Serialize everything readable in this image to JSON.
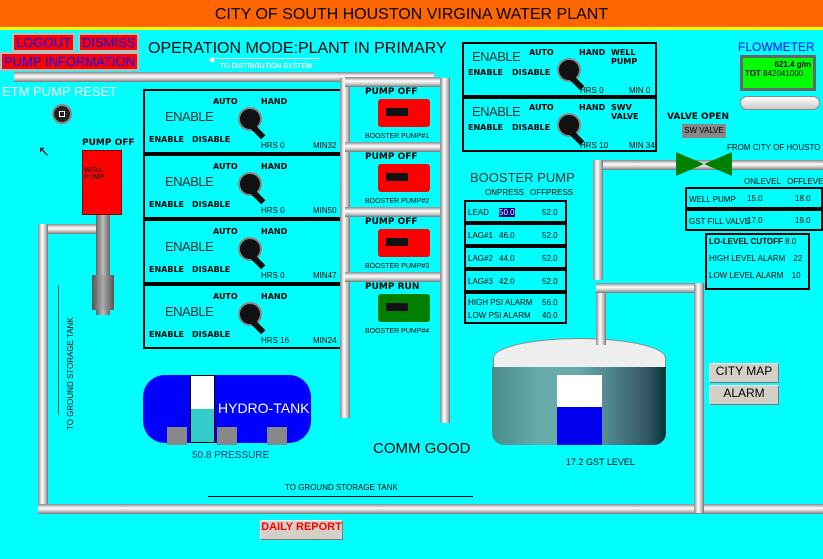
{
  "title": "CITY OF SOUTH HOUSTON VIRGINA WATER PLANT",
  "buttons": {
    "logout": "LOGOUT",
    "dismiss": "DISMISS",
    "pump_information": "PUMP INFORMATION",
    "city_map": "CITY MAP",
    "alarm": "ALARM",
    "daily_report": "DAILY REPORT"
  },
  "operation_mode": "OPERATION MODE:PLANT IN PRIMARY",
  "labels": {
    "to_distribution": "TO DISTRIBUTION SYSTEM",
    "etm_reset": "ETM PUMP RESET",
    "to_gst_vertical": "TO GROUND STORAGE TANK",
    "to_gst_horizontal": "TO GROUND STORAGE TANK",
    "from_city": "FROM CITY OF HOUSTO",
    "comm": "COMM GOOD",
    "flowmeter": "FLOWMETER"
  },
  "well_pump": {
    "status": "PUMP OFF",
    "label": "WELL PUMP"
  },
  "hoa_panels": [
    {
      "state": "ENABLE",
      "auto": "AUTO",
      "hand": "HAND",
      "enable": "ENABLE",
      "disable": "DISABLE",
      "hrs": "HRS 0",
      "min": "MIN32"
    },
    {
      "state": "ENABLE",
      "auto": "AUTO",
      "hand": "HAND",
      "enable": "ENABLE",
      "disable": "DISABLE",
      "hrs": "HRS 0",
      "min": "MIN50"
    },
    {
      "state": "ENABLE",
      "auto": "AUTO",
      "hand": "HAND",
      "enable": "ENABLE",
      "disable": "DISABLE",
      "hrs": "HRS 0",
      "min": "MIN47"
    },
    {
      "state": "ENABLE",
      "auto": "AUTO",
      "hand": "HAND",
      "enable": "ENABLE",
      "disable": "DISABLE",
      "hrs": "HRS 16",
      "min": "MIN24"
    }
  ],
  "right_panels": [
    {
      "state": "ENABLE",
      "auto": "AUTO",
      "hand": "HAND",
      "name": "WELL PUMP",
      "enable": "ENABLE",
      "disable": "DISABLE",
      "hrs": "HRS 0",
      "min": "MIN 0"
    },
    {
      "state": "ENABLE",
      "auto": "AUTO",
      "hand": "HAND",
      "name": "SWV VALVE",
      "enable": "ENABLE",
      "disable": "DISABLE",
      "hrs": "HRS 10",
      "min": "MIN 34"
    }
  ],
  "booster_pumps": [
    {
      "status": "PUMP OFF",
      "name": "BOOSTER PUMP#1",
      "color": "#ff0000"
    },
    {
      "status": "PUMP OFF",
      "name": "BOOSTER PUMP#2",
      "color": "#ff0000"
    },
    {
      "status": "PUMP OFF",
      "name": "BOOSTER PUMP#3",
      "color": "#ff0000"
    },
    {
      "status": "PUMP RUN",
      "name": "BOOSTER PUMP#4",
      "color": "#008000"
    }
  ],
  "booster_table": {
    "title": "BOOSTER PUMP",
    "col_on": "ONPRESS",
    "col_off": "OFFPRESS",
    "rows": [
      {
        "name": "LEAD",
        "on": "50.0",
        "off": "52.0"
      },
      {
        "name": "LAG#1",
        "on": "46.0",
        "off": "52.0"
      },
      {
        "name": "LAG#2",
        "on": "44.0",
        "off": "52.0"
      },
      {
        "name": "LAG#3",
        "on": "42.0",
        "off": "52.0"
      }
    ],
    "high_alarm_label": "HIGH PSI ALARM",
    "high_alarm": "56.0",
    "low_alarm_label": "LOW PSI ALARM",
    "low_alarm": "40.0"
  },
  "flowmeter": {
    "rate": "621.4 g/m",
    "tot_label": "TOT",
    "total": "842041000"
  },
  "valve": {
    "status": "VALVE OPEN",
    "name": "SW VALVE"
  },
  "level_table": {
    "col_on": "ONLEVEL",
    "col_off": "OFFLEVE",
    "rows": [
      {
        "name": "WELL PUMP",
        "on": "15.0",
        "off": "18.0"
      },
      {
        "name": "GST FILL VALVE",
        "on": "17.0",
        "off": "19.0"
      }
    ],
    "cutoff_label": "LO-LEVEL CUTOFF",
    "cutoff": "8.0",
    "high_label": "HIGH LEVEL ALARM",
    "high": "22",
    "low_label": "LOW LEVEL ALARM",
    "low": "10"
  },
  "hydro_tank": {
    "label": "HYDRO-TANK",
    "pressure_text": "50.8 PRESSURE",
    "fill_fraction": 0.5
  },
  "gst": {
    "level_text": "17.2  GST LEVEL",
    "fill_fraction": 0.55
  }
}
